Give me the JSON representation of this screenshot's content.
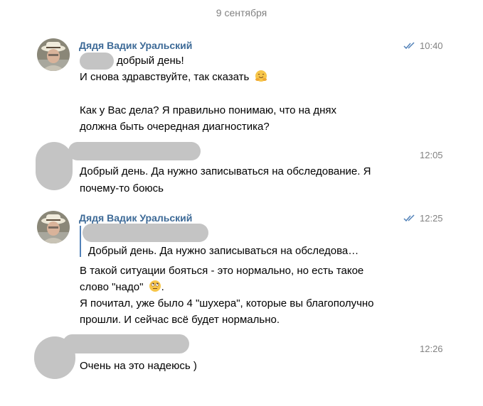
{
  "date": "9 сентября",
  "colors": {
    "sender_name": "#3d6a97",
    "time": "#828282",
    "ticks": "#5181b8",
    "blur": "#c4c4c4"
  },
  "messages": [
    {
      "sender": "Дядя Вадик Уральский",
      "time": "10:40",
      "read_ticks": true,
      "lines": [
        "добрый день!",
        "И снова здравствуйте, так сказать",
        "Как у Вас дела? Я правильно понимаю, что на днях",
        "должна быть очередная диагностика?"
      ],
      "emoji": "hugging-face-emoji"
    },
    {
      "sender": "",
      "time": "12:05",
      "read_ticks": false,
      "lines": [
        "Добрый день. Да нужно записываться на обследование. Я",
        "почему-то боюсь"
      ]
    },
    {
      "sender": "Дядя Вадик Уральский",
      "time": "12:25",
      "read_ticks": true,
      "quote": "Добрый день. Да нужно записываться на обследова…",
      "lines": [
        "В такой ситуации бояться - это нормально, но есть такое",
        "слово \"надо\"",
        ".",
        "Я почитал, уже было 4 \"шухера\", которые вы благополучно",
        "прошли. И сейчас всё будет нормально."
      ],
      "emoji": "eye-roll-emoji"
    },
    {
      "sender": "",
      "time": "12:26",
      "read_ticks": false,
      "lines": [
        "Очень на это надеюсь )"
      ]
    }
  ]
}
